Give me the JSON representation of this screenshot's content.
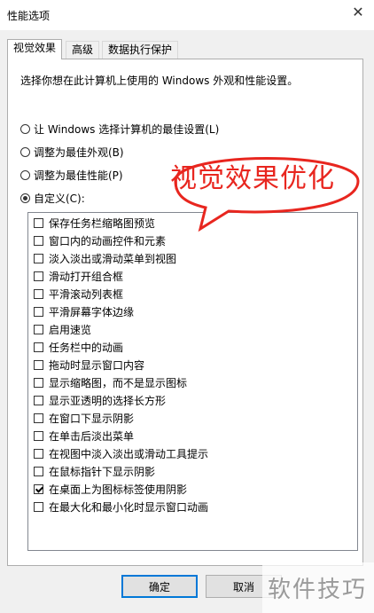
{
  "window": {
    "title": "性能选项"
  },
  "tabs": [
    {
      "label": "视觉效果",
      "active": true
    },
    {
      "label": "高级",
      "active": false
    },
    {
      "label": "数据执行保护",
      "active": false
    }
  ],
  "panel": {
    "intro": "选择你想在此计算机上使用的 Windows 外观和性能设置。",
    "radios": [
      {
        "label": "让 Windows 选择计算机的最佳设置(L)",
        "checked": false
      },
      {
        "label": "调整为最佳外观(B)",
        "checked": false
      },
      {
        "label": "调整为最佳性能(P)",
        "checked": false
      },
      {
        "label": "自定义(C):",
        "checked": true
      }
    ],
    "options": [
      {
        "label": "保存任务栏缩略图预览",
        "checked": false
      },
      {
        "label": "窗口内的动画控件和元素",
        "checked": false
      },
      {
        "label": "淡入淡出或滑动菜单到视图",
        "checked": false
      },
      {
        "label": "滑动打开组合框",
        "checked": false
      },
      {
        "label": "平滑滚动列表框",
        "checked": false
      },
      {
        "label": "平滑屏幕字体边缘",
        "checked": false
      },
      {
        "label": "启用速览",
        "checked": false
      },
      {
        "label": "任务栏中的动画",
        "checked": false
      },
      {
        "label": "拖动时显示窗口内容",
        "checked": false
      },
      {
        "label": "显示缩略图，而不是显示图标",
        "checked": false
      },
      {
        "label": "显示亚透明的选择长方形",
        "checked": false
      },
      {
        "label": "在窗口下显示阴影",
        "checked": false
      },
      {
        "label": "在单击后淡出菜单",
        "checked": false
      },
      {
        "label": "在视图中淡入淡出或滑动工具提示",
        "checked": false
      },
      {
        "label": "在鼠标指针下显示阴影",
        "checked": false
      },
      {
        "label": "在桌面上为图标标签使用阴影",
        "checked": true
      },
      {
        "label": "在最大化和最小化时显示窗口动画",
        "checked": false
      }
    ]
  },
  "buttons": {
    "ok": "确定",
    "cancel": "取消"
  },
  "annotation": {
    "callout_text": "视觉效果优化",
    "color": "#e8261f"
  },
  "watermark": "软件技巧",
  "icons": {
    "close": "close-icon"
  }
}
